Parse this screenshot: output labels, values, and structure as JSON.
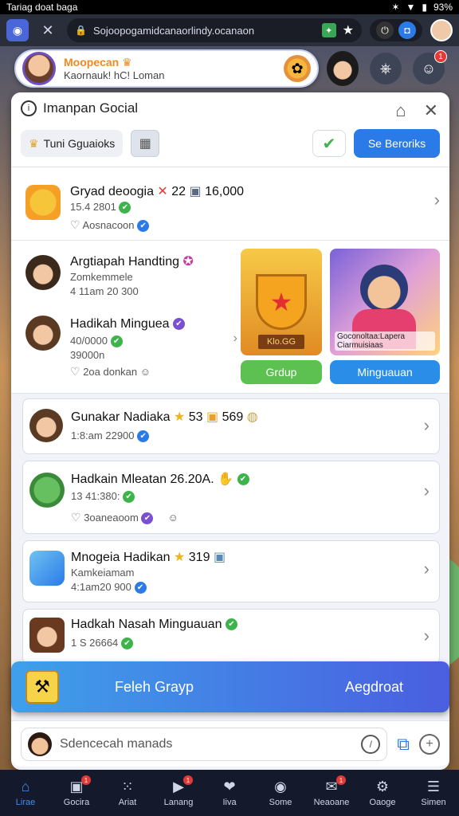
{
  "status": {
    "left_text": "Tariag doat baga",
    "battery": "93%"
  },
  "browser": {
    "url": "Sojoopogamidcanaorlindy.ocanaon"
  },
  "profile": {
    "name": "Moopecan",
    "subtitle": "Kaornauk! hC! Loman"
  },
  "panel": {
    "title": "Imanpan Gocial",
    "chip_label": "Tuni Gguaioks",
    "action_button": "Se Beroriks"
  },
  "rows": [
    {
      "title": "Gryad deoogia",
      "stat": "22",
      "stat2": "16,000",
      "sub1": "15.4 2801",
      "sub2": "Aosnacoon"
    },
    {
      "title": "Argtiapah Handting",
      "sub1": "Zomkemmele",
      "sub2": "4 11am 20 300"
    },
    {
      "title": "Hadikah Minguea",
      "sub1": "40/0000",
      "sub2": "39000n",
      "sub3": "2oa donkan"
    },
    {
      "title": "Gunakar Nadiaka",
      "stat": "53",
      "stat2": "569",
      "sub1": "1:8:am 22900"
    },
    {
      "title": "Hadkain Mleatan 26.20A.",
      "sub1": "13 41:380:",
      "sub2": "3oaneaoom"
    },
    {
      "title": "Mnogeia Hadikan",
      "stat": "319",
      "sub1": "Kamkeiamam",
      "sub2": "4:1am20 900"
    },
    {
      "title": "Hadkah Nasah Minguauan",
      "sub1": "1 S 26664"
    }
  ],
  "promo": {
    "trophy_plate": "Klo.GG",
    "hero_caption": "Goconoltaa:Lapera Ciarmuisiaas",
    "btn_left": "Grdup",
    "btn_right": "Minguauan"
  },
  "banner": {
    "left": "Feleh Grayp",
    "right": "Aegdroat"
  },
  "composer": {
    "placeholder": "Sdencecah manads"
  },
  "nav": [
    {
      "label": "Lirae",
      "icon": "home-icon",
      "badge": ""
    },
    {
      "label": "Gocira",
      "icon": "chat-icon",
      "badge": "1"
    },
    {
      "label": "Ariat",
      "icon": "apps-icon",
      "badge": ""
    },
    {
      "label": "Lanang",
      "icon": "video-icon",
      "badge": "1"
    },
    {
      "label": "Iiva",
      "icon": "heart-icon",
      "badge": ""
    },
    {
      "label": "Some",
      "icon": "globe-icon",
      "badge": ""
    },
    {
      "label": "Neaoane",
      "icon": "inbox-icon",
      "badge": "1"
    },
    {
      "label": "Oaoge",
      "icon": "settings-icon",
      "badge": ""
    },
    {
      "label": "Simen",
      "icon": "menu-icon",
      "badge": ""
    }
  ]
}
